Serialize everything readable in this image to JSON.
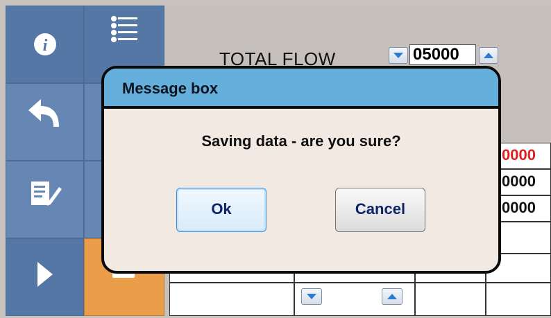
{
  "background_panel": {
    "flow_label": "TOTAL FLOW",
    "flow_value": "05000",
    "table_values": [
      "0000",
      "0000",
      "0000"
    ]
  },
  "sidebar": {
    "icons": [
      "info-icon",
      "list-icon",
      "back-icon",
      "edit-icon",
      "next-icon"
    ]
  },
  "dialog": {
    "title": "Message box",
    "message": "Saving data - are you sure?",
    "ok_label": "Ok",
    "cancel_label": "Cancel"
  },
  "colors": {
    "tile_blue": "#5577a6",
    "tile_orange": "#ea9e4a",
    "dialog_titlebar": "#64afdc",
    "dialog_body": "#f3e9e3",
    "value_red": "#e02020",
    "button_text": "#10246a"
  }
}
